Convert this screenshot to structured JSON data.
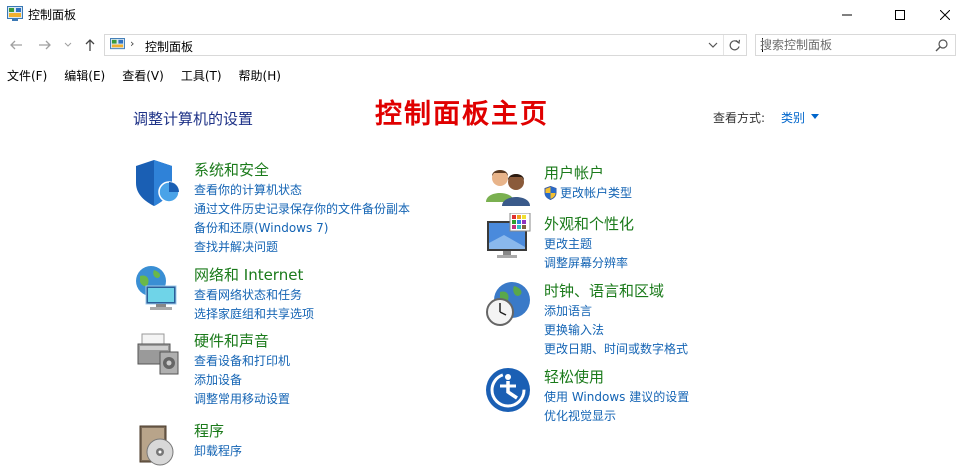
{
  "window": {
    "title": "控制面板",
    "icon": "control-panel-icon"
  },
  "address": {
    "location": "控制面板",
    "search_placeholder": "搜索控制面板"
  },
  "menu": [
    "文件(F)",
    "编辑(E)",
    "查看(V)",
    "工具(T)",
    "帮助(H)"
  ],
  "main": {
    "heading": "调整计算机的设置",
    "overlay_title": "控制面板主页",
    "view_by_label": "查看方式:",
    "view_by_value": "类别"
  },
  "categories": {
    "system": {
      "title": "系统和安全",
      "icon": "shield-icon",
      "links": [
        "查看你的计算机状态",
        "通过文件历史记录保存你的文件备份副本",
        "备份和还原(Windows 7)",
        "查找并解决问题"
      ]
    },
    "network": {
      "title": "网络和 Internet",
      "icon": "network-globe-icon",
      "links": [
        "查看网络状态和任务",
        "选择家庭组和共享选项"
      ]
    },
    "hardware": {
      "title": "硬件和声音",
      "icon": "printer-icon",
      "links": [
        "查看设备和打印机",
        "添加设备",
        "调整常用移动设置"
      ]
    },
    "programs": {
      "title": "程序",
      "icon": "programs-disc-icon",
      "links": [
        "卸载程序"
      ]
    },
    "users": {
      "title": "用户帐户",
      "icon": "users-icon",
      "links": [
        "更改帐户类型"
      ]
    },
    "appearance": {
      "title": "外观和个性化",
      "icon": "monitor-palette-icon",
      "links": [
        "更改主题",
        "调整屏幕分辨率"
      ]
    },
    "clock": {
      "title": "时钟、语言和区域",
      "icon": "clock-globe-icon",
      "links": [
        "添加语言",
        "更换输入法",
        "更改日期、时间或数字格式"
      ]
    },
    "ease": {
      "title": "轻松使用",
      "icon": "ease-of-access-icon",
      "links": [
        "使用 Windows 建议的设置",
        "优化视觉显示"
      ]
    }
  },
  "colors": {
    "category_title": "#1a7a1a",
    "link": "#1464b4",
    "heading": "#1e3287",
    "overlay": "#e00000"
  }
}
